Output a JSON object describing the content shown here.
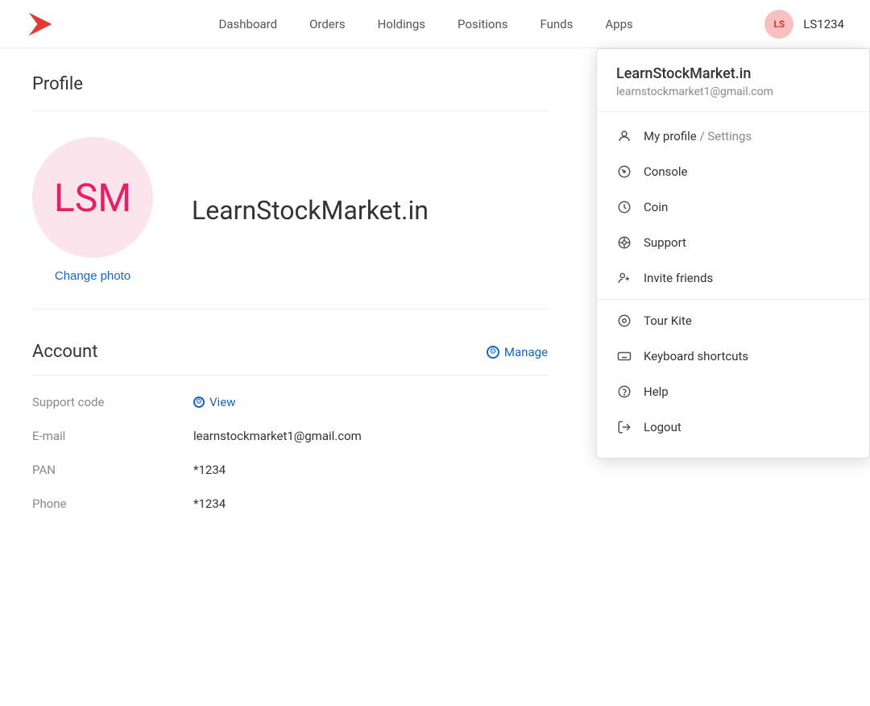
{
  "navbar": {
    "logo_alt": "Kite logo",
    "links": [
      {
        "label": "Dashboard",
        "id": "dashboard"
      },
      {
        "label": "Orders",
        "id": "orders"
      },
      {
        "label": "Holdings",
        "id": "holdings"
      },
      {
        "label": "Positions",
        "id": "positions"
      },
      {
        "label": "Funds",
        "id": "funds"
      },
      {
        "label": "Apps",
        "id": "apps"
      }
    ],
    "avatar_initials": "LS",
    "username": "LS1234"
  },
  "profile": {
    "title": "Profile",
    "avatar_initials": "LSM",
    "name": "LearnStockMarket.in",
    "change_photo_label": "Change photo"
  },
  "account": {
    "title": "Account",
    "manage_label": "Manage",
    "fields": [
      {
        "label": "Support code",
        "type": "link",
        "value": "View"
      },
      {
        "label": "E-mail",
        "type": "text",
        "value": "learnstockmarket1@gmail.com"
      },
      {
        "label": "PAN",
        "type": "text",
        "value": "*1234"
      },
      {
        "label": "Phone",
        "type": "text",
        "value": "*1234"
      }
    ]
  },
  "dropdown": {
    "username": "LearnStockMarket.in",
    "email": "learnstockmarket1@gmail.com",
    "items": [
      {
        "id": "profile",
        "label": "My profile",
        "sublabel": "/ Settings",
        "icon": "person"
      },
      {
        "id": "console",
        "label": "Console",
        "sublabel": "",
        "icon": "gauge"
      },
      {
        "id": "coin",
        "label": "Coin",
        "sublabel": "",
        "icon": "clock"
      },
      {
        "id": "support",
        "label": "Support",
        "sublabel": "",
        "icon": "headset"
      },
      {
        "id": "invite",
        "label": "Invite friends",
        "sublabel": "",
        "icon": "person-add"
      },
      {
        "id": "tour",
        "label": "Tour Kite",
        "sublabel": "",
        "icon": "tour"
      },
      {
        "id": "keyboard",
        "label": "Keyboard shortcuts",
        "sublabel": "",
        "icon": "keyboard"
      },
      {
        "id": "help",
        "label": "Help",
        "sublabel": "",
        "icon": "help"
      },
      {
        "id": "logout",
        "label": "Logout",
        "sublabel": "",
        "icon": "logout"
      }
    ]
  }
}
